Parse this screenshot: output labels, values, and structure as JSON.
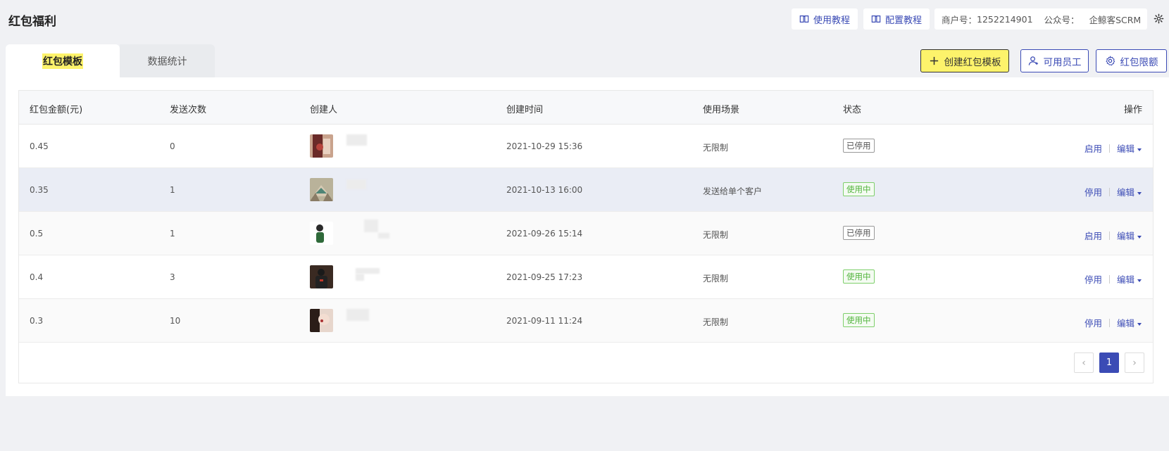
{
  "header": {
    "title": "红包福利",
    "tutorial_btn": "使用教程",
    "config_btn": "配置教程",
    "merchant_label": "商户号：",
    "merchant_id": "1252214901",
    "account_label": "公众号：",
    "account_name": "企鲸客SCRM"
  },
  "tabs": [
    {
      "label": "红包模板",
      "active": true
    },
    {
      "label": "数据统计",
      "active": false
    }
  ],
  "actions": {
    "create": "创建红包模板",
    "staff": "可用员工",
    "limit": "红包限额"
  },
  "table": {
    "columns": [
      "红包金额(元)",
      "发送次数",
      "创建人",
      "创建时间",
      "使用场景",
      "状态",
      "操作"
    ],
    "rows": [
      {
        "amount": "0.45",
        "count": "0",
        "time": "2021-10-29 15:36",
        "scene": "无限制",
        "status": "已停用",
        "status_on": false,
        "op1": "启用",
        "op2": "编辑"
      },
      {
        "amount": "0.35",
        "count": "1",
        "time": "2021-10-13 16:00",
        "scene": "发送给单个客户",
        "status": "使用中",
        "status_on": true,
        "op1": "停用",
        "op2": "编辑"
      },
      {
        "amount": "0.5",
        "count": "1",
        "time": "2021-09-26 15:14",
        "scene": "无限制",
        "status": "已停用",
        "status_on": false,
        "op1": "启用",
        "op2": "编辑"
      },
      {
        "amount": "0.4",
        "count": "3",
        "time": "2021-09-25 17:23",
        "scene": "无限制",
        "status": "使用中",
        "status_on": true,
        "op1": "停用",
        "op2": "编辑"
      },
      {
        "amount": "0.3",
        "count": "10",
        "time": "2021-09-11 11:24",
        "scene": "无限制",
        "status": "使用中",
        "status_on": true,
        "op1": "停用",
        "op2": "编辑"
      }
    ]
  },
  "pagination": {
    "current": "1",
    "prev": "‹",
    "next": "›"
  },
  "colors": {
    "accent": "#3b4bb5",
    "highlight": "#fdf36b",
    "active_green": "#52b43d"
  }
}
